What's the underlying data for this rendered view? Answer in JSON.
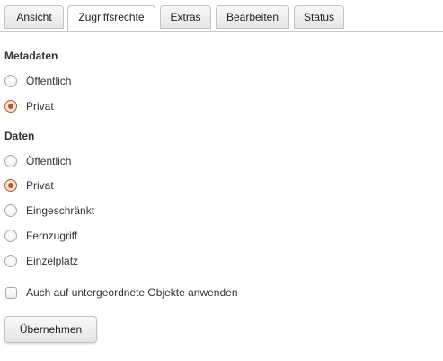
{
  "tabs": [
    {
      "label": "Ansicht",
      "active": false
    },
    {
      "label": "Zugriffsrechte",
      "active": true
    },
    {
      "label": "Extras",
      "active": false
    },
    {
      "label": "Bearbeiten",
      "active": false
    },
    {
      "label": "Status",
      "active": false
    }
  ],
  "metadata": {
    "title": "Metadaten",
    "options": [
      {
        "label": "Öffentlich",
        "checked": false
      },
      {
        "label": "Privat",
        "checked": true
      }
    ]
  },
  "data_section": {
    "title": "Daten",
    "options": [
      {
        "label": "Öffentlich",
        "checked": false
      },
      {
        "label": "Privat",
        "checked": true
      },
      {
        "label": "Eingeschränkt",
        "checked": false
      },
      {
        "label": "Fernzugriff",
        "checked": false
      },
      {
        "label": "Einzelplatz",
        "checked": false
      }
    ]
  },
  "apply_to_children": {
    "label": "Auch auf untergeordnete Objekte anwenden",
    "checked": false
  },
  "apply_button": {
    "label": "Übernehmen"
  },
  "colors": {
    "accent": "#c5521f"
  }
}
